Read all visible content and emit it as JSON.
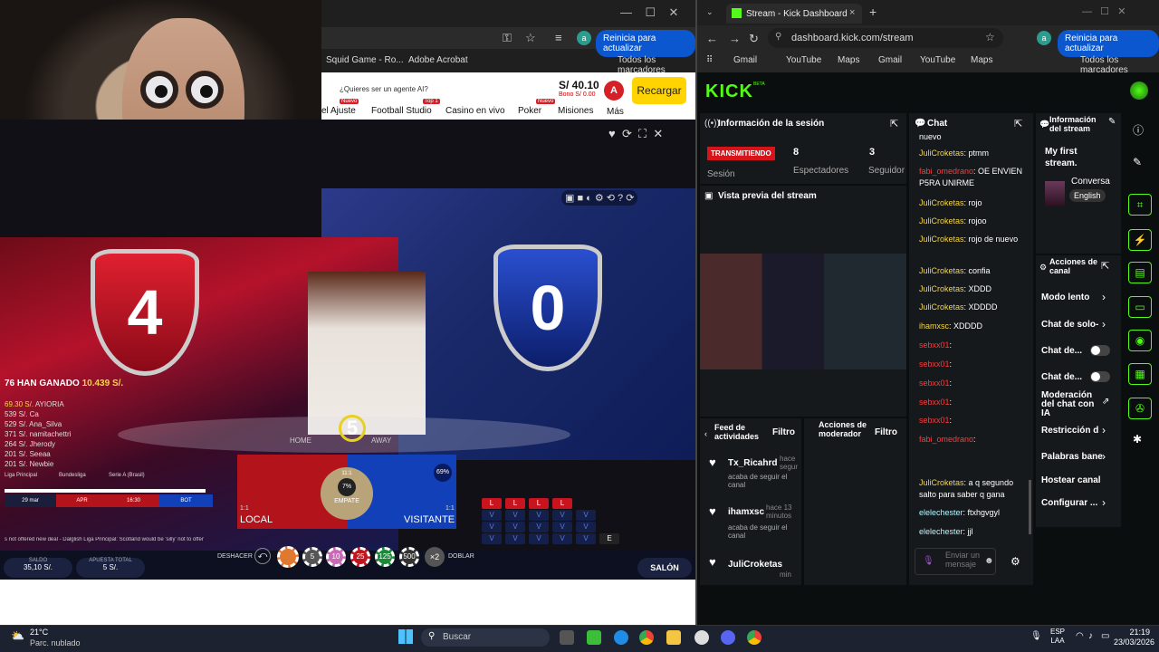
{
  "left_browser": {
    "address": "",
    "update_button": "Reinicia para actualizar",
    "bookmarks": [
      "Squid Game - Ro...",
      "Adobe Acrobat",
      "Todos los marcadores"
    ]
  },
  "casino": {
    "promo": "¿Quieres ser un agente AI?",
    "balance": "S/ 40.10",
    "bono": "Bono S/ 0.00",
    "avatar": "A",
    "recargar": "Recargar",
    "nav": [
      "el Ajuste",
      "Football Studio",
      "Casino en vivo",
      "Poker",
      "Misiones",
      "Más"
    ],
    "badges": [
      "Nuevo",
      "Top 1",
      "Nuevo"
    ]
  },
  "game": {
    "score_left": "4",
    "score_right": "0",
    "timer": "5",
    "won_label": "HAN GANADO",
    "won_count": "76",
    "won_amount": "10.439 S/.",
    "winners": [
      {
        "amount": "69.30 S/.",
        "name": "AYIORIA"
      },
      {
        "amount": "539 S/.",
        "name": "Ca"
      },
      {
        "amount": "529 S/.",
        "name": "Ana_Silva"
      },
      {
        "amount": "371 S/.",
        "name": "namitachettri"
      },
      {
        "amount": "264 S/.",
        "name": "Jherody"
      },
      {
        "amount": "201 S/.",
        "name": "Seeaa"
      },
      {
        "amount": "201 S/.",
        "name": "Newbie"
      }
    ],
    "leagues": [
      "Liga Principal",
      "Bundesliga",
      "Serie A (Brasil)"
    ],
    "league_tabs": [
      "29 mar",
      "APR",
      "16:30",
      "BOT"
    ],
    "ticker": "s not offered new deal - Dalglish   Liga Principal: Scotland would be 'silly' not to offer",
    "local": "LOCAL",
    "visitante": "VISITANTE",
    "empate": "EMPATE",
    "empate_pct": "7%",
    "local_ratio": "1:1",
    "visit_ratio": "1:1",
    "empate_ratio": "11:1",
    "visit_pct": "69%",
    "home": "HOME",
    "away": "AWAY",
    "undo": "DESHACER",
    "double": "DOBLAR",
    "chips": [
      "5",
      "10",
      "25",
      "125",
      "500",
      "×2"
    ],
    "saldo_label": "SALDO",
    "saldo": "35,10 S/.",
    "apuesta_label": "APUESTA TOTAL",
    "apuesta": "5 S/.",
    "salon": "SALÓN",
    "history_rows": [
      [
        "L",
        "L",
        "L",
        "L",
        "",
        ""
      ],
      [
        "V",
        "V",
        "V",
        "V",
        "V",
        ""
      ],
      [
        "V",
        "V",
        "V",
        "V",
        "V",
        ""
      ],
      [
        "V",
        "V",
        "V",
        "V",
        "V",
        "E"
      ]
    ]
  },
  "right_browser": {
    "tab_title": "Stream - Kick Dashboard",
    "address": "dashboard.kick.com/stream",
    "update_button": "Reinicia para actualizar",
    "bookmarks": [
      "Gmail",
      "YouTube",
      "Maps",
      "Gmail",
      "YouTube",
      "Maps",
      "Todos los marcadores"
    ]
  },
  "kick": {
    "logo": "KICK",
    "logo_sup": "BETA",
    "session": {
      "title": "Información de la sesión",
      "status": "TRANSMITIENDO",
      "status_label": "Sesión",
      "viewers": "8",
      "viewers_label": "Espectadores",
      "followers": "3",
      "followers_label": "Seguidor"
    },
    "preview_title": "Vista previa del stream",
    "feed": {
      "title": "Feed de actividades",
      "filter": "Filtro",
      "items": [
        {
          "name": "Tx_Ricahrd",
          "time": "hace segur",
          "text": "acaba de seguir el canal"
        },
        {
          "name": "ihamxsc",
          "time": "hace 13 minutos",
          "text": "acaba de seguir el canal"
        },
        {
          "name": "JuliCroketas",
          "time": "min",
          "text": ""
        }
      ]
    },
    "mod_actions": {
      "title": "Acciones de moderador",
      "filter": "Filtro"
    },
    "chat": {
      "title": "Chat",
      "input_placeholder": "Enviar un mensaje",
      "messages": [
        {
          "user": "",
          "text": "nuevo",
          "color": "nick-g"
        },
        {
          "user": "JuliCroketas",
          "text": ": ptmm",
          "color": "nick-y"
        },
        {
          "user": "fabi_omedrano",
          "text": ": OE ENVIEN P5RA UNIRME",
          "color": "nick-r"
        },
        {
          "user": "JuliCroketas",
          "text": ": rojo",
          "color": "nick-y"
        },
        {
          "user": "JuliCroketas",
          "text": ": rojoo",
          "color": "nick-y"
        },
        {
          "user": "JuliCroketas",
          "text": ": rojo de nuevo",
          "color": "nick-y"
        },
        {
          "user": "JuliCroketas",
          "text": ": confia",
          "color": "nick-y"
        },
        {
          "user": "JuliCroketas",
          "text": ": XDDD",
          "color": "nick-y"
        },
        {
          "user": "JuliCroketas",
          "text": ": XDDDD",
          "color": "nick-y"
        },
        {
          "user": "ihamxsc",
          "text": ": XDDDD",
          "color": "nick-y"
        },
        {
          "user": "sebxx01",
          "text": ":",
          "color": "nick-r"
        },
        {
          "user": "sebxx01",
          "text": ":",
          "color": "nick-r"
        },
        {
          "user": "sebxx01",
          "text": ":",
          "color": "nick-r"
        },
        {
          "user": "sebxx01",
          "text": ":",
          "color": "nick-r"
        },
        {
          "user": "sebxx01",
          "text": ":",
          "color": "nick-r"
        },
        {
          "user": "fabi_omedrano",
          "text": ":",
          "color": "nick-r"
        },
        {
          "user": "JuliCroketas",
          "text": ": a q segundo salto para saber q gana",
          "color": "nick-y"
        },
        {
          "user": "elelechester",
          "text": ": ftxhgvgyl",
          "color": "nick-c"
        },
        {
          "user": "elelechester",
          "text": ": jjl",
          "color": "nick-c"
        }
      ]
    },
    "stream_info": {
      "title": "Información del stream",
      "stream_title": "My first stream.",
      "category": "Conversa",
      "language": "English"
    },
    "channel_actions": {
      "title": "Acciones de canal",
      "items": [
        "Modo lento",
        "Chat de solo-",
        "Chat de...",
        "Chat de...",
        "Moderación del chat con IA",
        "Restricción d",
        "Palabras bane",
        "Hostear canal",
        "Configurar ..."
      ]
    }
  },
  "taskbar": {
    "weather_temp": "21°C",
    "weather_desc": "Parc. nublado",
    "search": "Buscar",
    "lang": "ESP",
    "lang2": "LAA",
    "time": "21:19",
    "date": "23/03/2026"
  },
  "colors": {
    "kick_green": "#53fc18",
    "taskbar": "#1c2230",
    "recargar": "#ffd400"
  }
}
